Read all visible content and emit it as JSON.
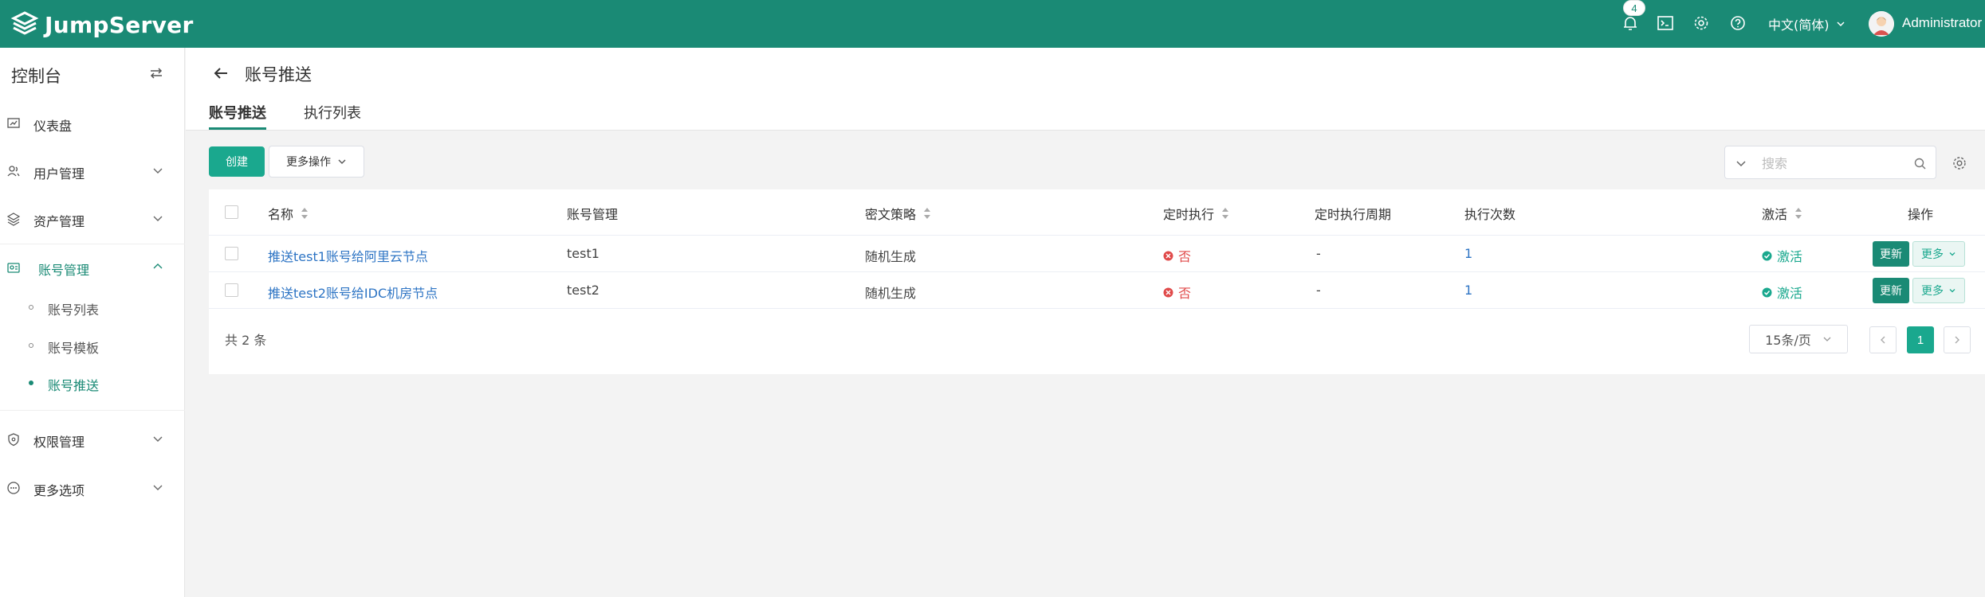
{
  "header": {
    "brand": "JumpServer",
    "notification_count": "4",
    "language": "中文(简体)",
    "username": "Administrator",
    "brand_color": "#1a8a75"
  },
  "sidebar": {
    "title": "控制台",
    "items": [
      {
        "label": "仪表盘",
        "icon": "dashboard-icon"
      },
      {
        "label": "用户管理",
        "icon": "users-icon"
      },
      {
        "label": "资产管理",
        "icon": "assets-icon"
      },
      {
        "label": "账号管理",
        "icon": "account-icon"
      },
      {
        "label": "权限管理",
        "icon": "shield-icon"
      },
      {
        "label": "更多选项",
        "icon": "more-icon"
      }
    ],
    "account_subitems": [
      {
        "label": "账号列表"
      },
      {
        "label": "账号模板"
      },
      {
        "label": "账号推送"
      }
    ]
  },
  "page": {
    "title": "账号推送",
    "tabs": [
      {
        "label": "账号推送"
      },
      {
        "label": "执行列表"
      }
    ]
  },
  "toolbar": {
    "create_label": "创建",
    "more_actions_label": "更多操作",
    "search_placeholder": "搜索"
  },
  "table": {
    "columns": [
      "名称",
      "账号管理",
      "密文策略",
      "定时执行",
      "定时执行周期",
      "执行次数",
      "激活",
      "操作"
    ],
    "rows": [
      {
        "name": "推送test1账号给阿里云节点",
        "account": "test1",
        "secret_strategy": "随机生成",
        "is_periodic": "否",
        "period": "-",
        "exec_count": "1",
        "active": "激活"
      },
      {
        "name": "推送test2账号给IDC机房节点",
        "account": "test2",
        "secret_strategy": "随机生成",
        "is_periodic": "否",
        "period": "-",
        "exec_count": "1",
        "active": "激活"
      }
    ],
    "update_label": "更新",
    "more_label": "更多"
  },
  "pagination": {
    "total_text": "共 2 条",
    "page_size": "15条/页",
    "current_page": "1"
  }
}
